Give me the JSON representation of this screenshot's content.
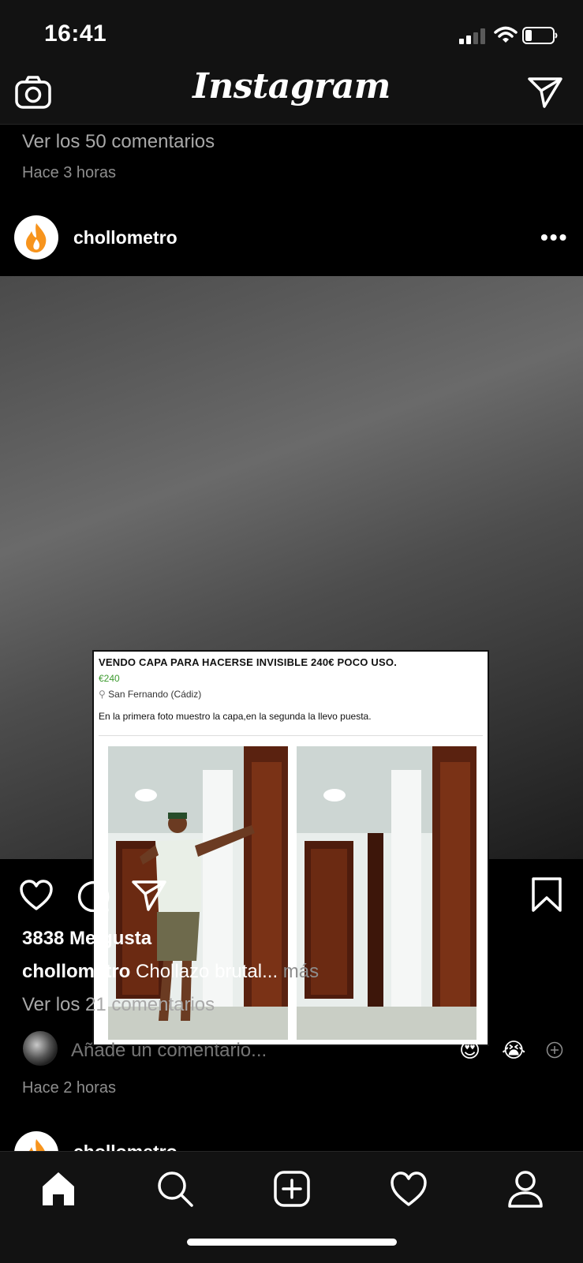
{
  "status_bar": {
    "time": "16:41"
  },
  "header": {
    "app_name": "Instagram"
  },
  "previous_post": {
    "view_comments": "Ver los 50 comentarios",
    "timestamp": "Hace 3 horas"
  },
  "post": {
    "username": "chollometro",
    "more_label": "•••",
    "image": {
      "ad_title": "VENDO CAPA PARA HACERSE INVISIBLE 240€ POCO USO.",
      "ad_price": "€240",
      "ad_location": "San Fernando (Cádiz)",
      "ad_description": "En la primera foto muestro la capa,en la segunda la llevo puesta."
    },
    "likes": "3838 Me gusta",
    "caption_user": "chollometro",
    "caption_text": "Chollazo brutal...",
    "caption_more": "más",
    "view_comments": "Ver los 21 comentarios",
    "comment_placeholder": "Añade un comentario...",
    "quick_emojis": [
      "😍",
      "😭"
    ],
    "timestamp": "Hace 2 horas"
  },
  "next_post": {
    "username": "chollometro"
  },
  "tab_bar": {
    "items": [
      "home-icon",
      "search-icon",
      "new-post-icon",
      "activity-icon",
      "profile-icon"
    ]
  }
}
